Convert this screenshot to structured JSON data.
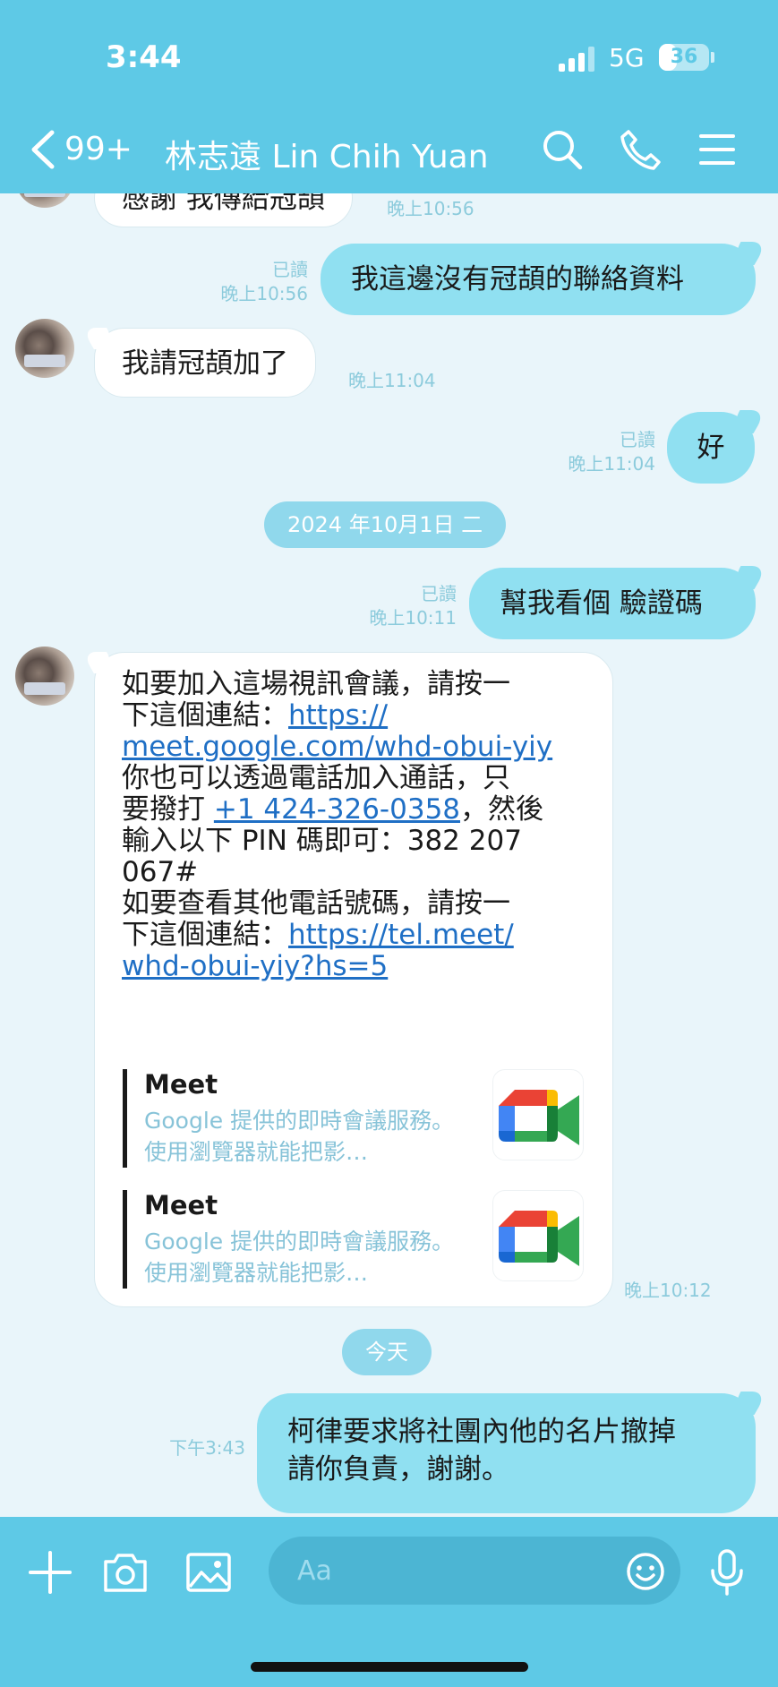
{
  "status_bar": {
    "time": "3:44",
    "network": "5G",
    "battery": "36",
    "battery_level": 0.36
  },
  "header": {
    "unread_count": "99+",
    "title": "林志遠 Lin Chih Yuan"
  },
  "messages": [
    {
      "side": "in",
      "text": "感謝 我傳給冠頡",
      "time": "晚上10:56"
    },
    {
      "side": "out",
      "read": "已讀",
      "time": "晚上10:56",
      "text": "我這邊沒有冠頡的聯絡資料"
    },
    {
      "side": "in",
      "text": "我請冠頡加了",
      "time": "晚上11:04"
    },
    {
      "side": "out",
      "read": "已讀",
      "time": "晚上11:04",
      "text": "好"
    },
    {
      "side": "out",
      "read": "已讀",
      "time": "晚上10:11",
      "text": "幫我看個 驗證碼"
    },
    {
      "side": "in",
      "time": "晚上10:12",
      "line1": "如要加入這場視訊會議，請按一",
      "line2_prefix": "下這個連結：",
      "link1a": "https://",
      "link1b": "meet.google.com/whd-obui-yiy",
      "line4": "你也可以透過電話加入通話，只",
      "line5_prefix": "要撥打 ",
      "phone": "+1 424-326-0358",
      "line5_suffix": "，然後",
      "line6": "輸入以下 PIN 碼即可：382 207",
      "line7": "067#",
      "line8": "如要查看其他電話號碼，請按一",
      "line9_prefix": "下這個連結：",
      "link2a": "https://tel.meet/",
      "link2b": "whd-obui-yiy?hs=5",
      "previews": [
        {
          "title": "Meet",
          "desc": "Google 提供的即時會議服務。使用瀏覽器就能把影…"
        },
        {
          "title": "Meet",
          "desc": "Google 提供的即時會議服務。使用瀏覽器就能把影…"
        }
      ]
    },
    {
      "side": "out",
      "time": "下午3:43",
      "line1": "柯律要求將社團內他的名片撤掉",
      "line2": "請你負責，謝謝。"
    }
  ],
  "date_chips": {
    "oct1": "2024 年10月1日 二",
    "today": "今天"
  },
  "input": {
    "placeholder": "Aa"
  },
  "colors": {
    "theme": "#5ec9e6",
    "bubble_out": "#90e0f1",
    "link": "#1f6fc5",
    "meta": "#8ccbdc"
  }
}
